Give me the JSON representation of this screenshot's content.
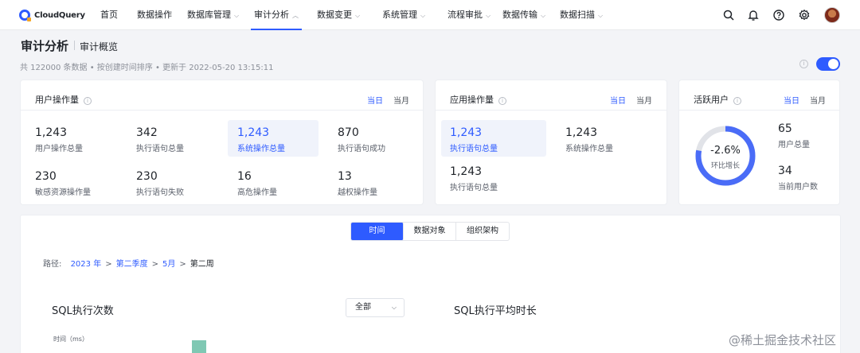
{
  "brand": {
    "name": "CloudQuery"
  },
  "nav": {
    "items": [
      {
        "label": "首页",
        "dropdown": false
      },
      {
        "label": "数据操作",
        "dropdown": false
      },
      {
        "label": "数据库管理",
        "dropdown": true
      },
      {
        "label": "审计分析",
        "dropdown": true,
        "active": true
      },
      {
        "label": "数据变更",
        "dropdown": true
      },
      {
        "label": "系统管理",
        "dropdown": true
      },
      {
        "label": "流程审批",
        "dropdown": true
      },
      {
        "label": "数据传输",
        "dropdown": true
      },
      {
        "label": "数据扫描",
        "dropdown": true
      }
    ],
    "icons": [
      "search-icon",
      "bell-icon",
      "help-icon",
      "settings-icon"
    ]
  },
  "header": {
    "title": "审计分析",
    "subtitle": "审计概览",
    "meta": "共 122000 条数据 • 按创建时间排序 • 更新于 2022-05-20 13:15:11",
    "toggle_on": true
  },
  "user_ops": {
    "title": "用户操作量",
    "seg_day": "当日",
    "seg_month": "当月",
    "stats": [
      {
        "value": "1,243",
        "label": "用户操作总量"
      },
      {
        "value": "342",
        "label": "执行语句总量"
      },
      {
        "value": "1,243",
        "label": "系统操作总量",
        "highlight": true
      },
      {
        "value": "870",
        "label": "执行语句成功"
      },
      {
        "value": "230",
        "label": "敏感资源操作量"
      },
      {
        "value": "230",
        "label": "执行语句失败"
      },
      {
        "value": "16",
        "label": "高危操作量"
      },
      {
        "value": "13",
        "label": "越权操作量"
      }
    ]
  },
  "app_ops": {
    "title": "应用操作量",
    "seg_day": "当日",
    "seg_month": "当月",
    "stats": [
      {
        "value": "1,243",
        "label": "执行语句总量",
        "highlight": true
      },
      {
        "value": "1,243",
        "label": "系统操作总量"
      },
      {
        "value": "1,243",
        "label": "执行语句总量"
      }
    ]
  },
  "active_users": {
    "title": "活跃用户",
    "seg_day": "当日",
    "seg_month": "当月",
    "ring_value": "-2.6%",
    "ring_label": "环比增长",
    "ring_fill": 0.78,
    "stats": [
      {
        "value": "65",
        "label": "用户总量"
      },
      {
        "value": "34",
        "label": "当前用户数"
      }
    ]
  },
  "panel": {
    "tabs": [
      "时间",
      "数据对象",
      "组织架构"
    ],
    "breadcrumb": {
      "prefix": "路径:",
      "links": [
        "2023 年",
        "第二季度",
        "5月"
      ],
      "current": "第二周"
    },
    "sql_count_title": "SQL执行次数",
    "select_value": "全部",
    "sql_avg_title": "SQL执行平均时长",
    "axis_label": "时间（ms）"
  },
  "watermark": "@稀土掘金技术社区",
  "colors": {
    "accent": "#2e5bff",
    "bar": "#7fc8b3",
    "ring_track": "#e1e3e8"
  }
}
